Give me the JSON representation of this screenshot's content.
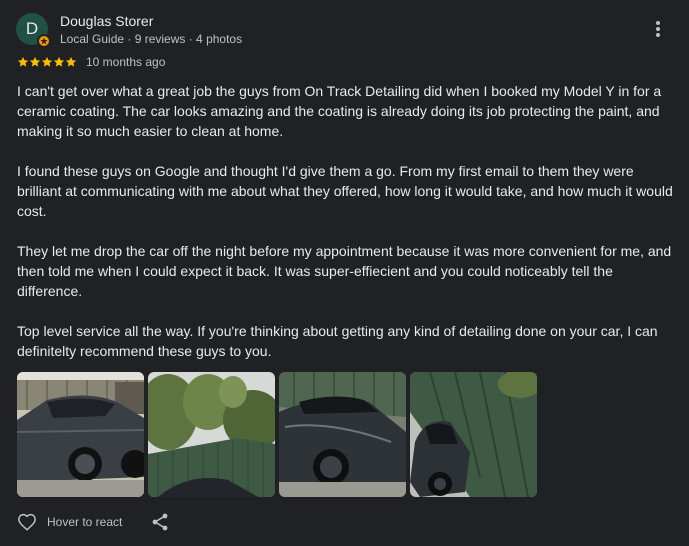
{
  "review": {
    "author": {
      "name": "Douglas Storer",
      "initial": "D",
      "meta": "Local Guide · 9 reviews · 4 photos"
    },
    "rating": 5,
    "time": "10 months ago",
    "paragraphs": [
      "I can't get over what a great job the guys from On Track Detailing did when I booked my Model Y in for a ceramic coating. The car looks amazing and the coating is already doing its job protecting the paint, and making it so much easier to clean at home.",
      "I found these guys on Google and thought I'd give them a go. From my first email to them they were brilliant at communicating with me about what they offered, how long it would take, and how much it would cost.",
      "They let me drop the car off the night before my appointment because it was more convenient for me, and then told me when I could expect it back. It was super-effiecient and you could noticeably tell the difference.",
      "Top level service all the way. If you're thinking about getting any kind of detailing done on your car, I can definitelty recommend these guys to you."
    ],
    "photo_count_shown": 4,
    "actions": {
      "react_label": "Hover to react"
    }
  },
  "icons": {
    "more": "more-vert-icon",
    "star": "star-icon",
    "guide_badge": "local-guide-badge-icon",
    "heart": "heart-outline-icon",
    "share": "share-icon"
  },
  "colors": {
    "background": "#202124",
    "text_primary": "#e8eaed",
    "text_secondary": "#bdc1c6",
    "star": "#fbbc04",
    "avatar_bg": "#1f5144",
    "badge": "#f29900"
  }
}
